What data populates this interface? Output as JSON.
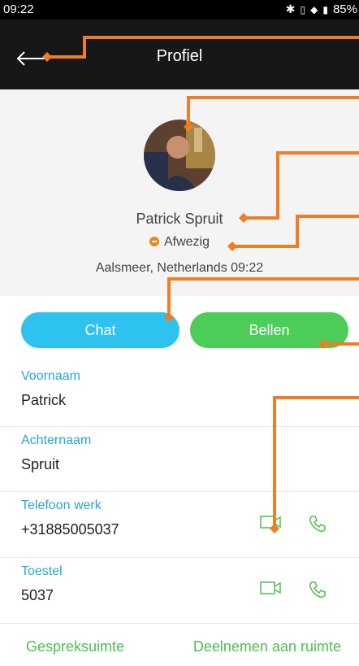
{
  "status_bar": {
    "time": "09:22",
    "battery": "85%"
  },
  "header": {
    "title": "Profiel"
  },
  "profile": {
    "name": "Patrick Spruit",
    "status": "Afwezig",
    "location": "Aalsmeer, Netherlands 09:22"
  },
  "actions": {
    "chat_label": "Chat",
    "call_label": "Bellen"
  },
  "fields": [
    {
      "label": "Voornaam",
      "value": "Patrick"
    },
    {
      "label": "Achternaam",
      "value": "Spruit"
    },
    {
      "label": "Telefoon werk",
      "value": "+31885005037"
    },
    {
      "label": "Toestel",
      "value": "5037"
    }
  ],
  "footer": {
    "left": "Gespreksuimte",
    "right": "Deelnemen aan ruimte"
  },
  "colors": {
    "chat_button": "#2ec2ee",
    "call_button": "#4ccd5a",
    "link_blue": "#25a6d7",
    "green": "#4cbf4e",
    "status_away": "#e08c21",
    "annotation": "#ee7d24"
  }
}
